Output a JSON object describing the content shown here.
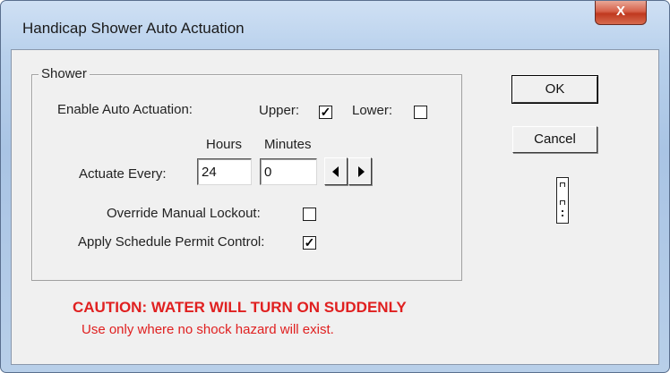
{
  "window": {
    "title": "Handicap Shower Auto Actuation",
    "close_label": "X"
  },
  "shower_group": {
    "label": "Shower",
    "enable_auto_actuation_label": "Enable Auto Actuation:",
    "upper_label": "Upper:",
    "upper_checked": true,
    "lower_label": "Lower:",
    "lower_checked": false,
    "hours_header": "Hours",
    "minutes_header": "Minutes",
    "actuate_every_label": "Actuate Every:",
    "hours_value": "24",
    "minutes_value": "0",
    "override_label": "Override Manual Lockout:",
    "override_checked": false,
    "apply_schedule_label": "Apply Schedule Permit Control:",
    "apply_schedule_checked": true,
    "check_mark": "✓"
  },
  "buttons": {
    "ok_label": "OK",
    "cancel_label": "Cancel"
  },
  "icons": {
    "device": "shower-device-icon",
    "left": "arrow-left-icon",
    "right": "arrow-right-icon"
  },
  "caution": {
    "headline": "CAUTION: WATER WILL TURN ON SUDDENLY",
    "subtext": "Use only where no shock hazard will exist."
  },
  "colors": {
    "caution": "#e02020",
    "close_button": "#c0391f",
    "window_frame": "#b9d1ec"
  }
}
